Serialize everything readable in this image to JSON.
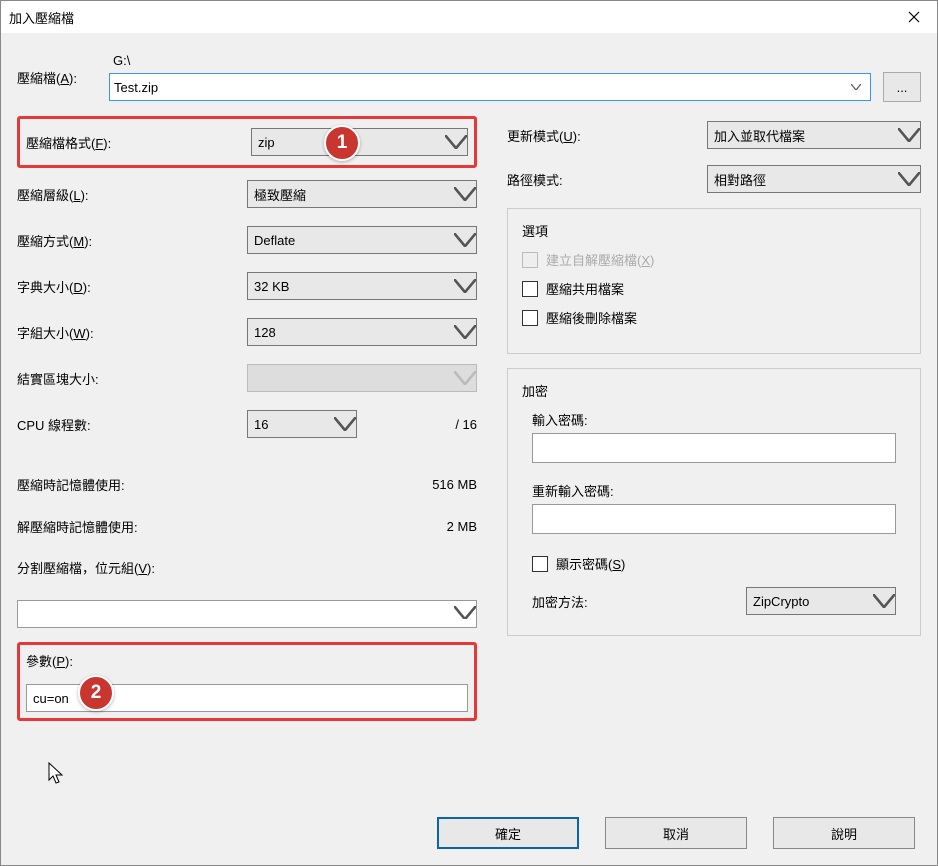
{
  "window": {
    "title": "加入壓縮檔"
  },
  "archive": {
    "label": "壓縮檔(<u>A</u>):",
    "path": "G:\\",
    "name": "Test.zip",
    "browse": "..."
  },
  "left": {
    "format": {
      "label": "壓縮檔格式(<u>F</u>):",
      "value": "zip"
    },
    "level": {
      "label": "壓縮層級(<u>L</u>):",
      "value": "極致壓縮"
    },
    "method": {
      "label": "壓縮方式(<u>M</u>):",
      "value": "Deflate"
    },
    "dict": {
      "label": "字典大小(<u>D</u>):",
      "value": "32 KB"
    },
    "word": {
      "label": "字組大小(<u>W</u>):",
      "value": "128"
    },
    "solid": {
      "label": "結實區塊大小:",
      "value": ""
    },
    "threads": {
      "label": "CPU 線程數:",
      "value": "16",
      "total": "/ 16"
    },
    "comp_mem": {
      "label": "壓縮時記憶體使用:",
      "value": "516 MB"
    },
    "decomp_mem": {
      "label": "解壓縮時記憶體使用:",
      "value": "2 MB"
    },
    "volumes": {
      "label": "分割壓縮檔，位元組(<u>V</u>):",
      "value": ""
    },
    "params": {
      "label": "參數(<u>P</u>):",
      "value": "cu=on"
    }
  },
  "right": {
    "update": {
      "label": "更新模式(<u>U</u>):",
      "value": "加入並取代檔案"
    },
    "pathmode": {
      "label": "路徑模式:",
      "value": "相對路徑"
    },
    "options": {
      "legend": "選項",
      "sfx": "建立自解壓縮檔(<u>X</u>)",
      "compress_shared": "壓縮共用檔案",
      "delete_after": "壓縮後刪除檔案"
    },
    "encrypt": {
      "legend": "加密",
      "password_label": "輸入密碼:",
      "reenter_label": "重新輸入密碼:",
      "show_password": "顯示密碼(<u>S</u>)",
      "method_label": "加密方法:",
      "method_value": "ZipCrypto"
    }
  },
  "buttons": {
    "ok": "確定",
    "cancel": "取消",
    "help": "說明"
  },
  "badges": {
    "one": "1",
    "two": "2"
  }
}
